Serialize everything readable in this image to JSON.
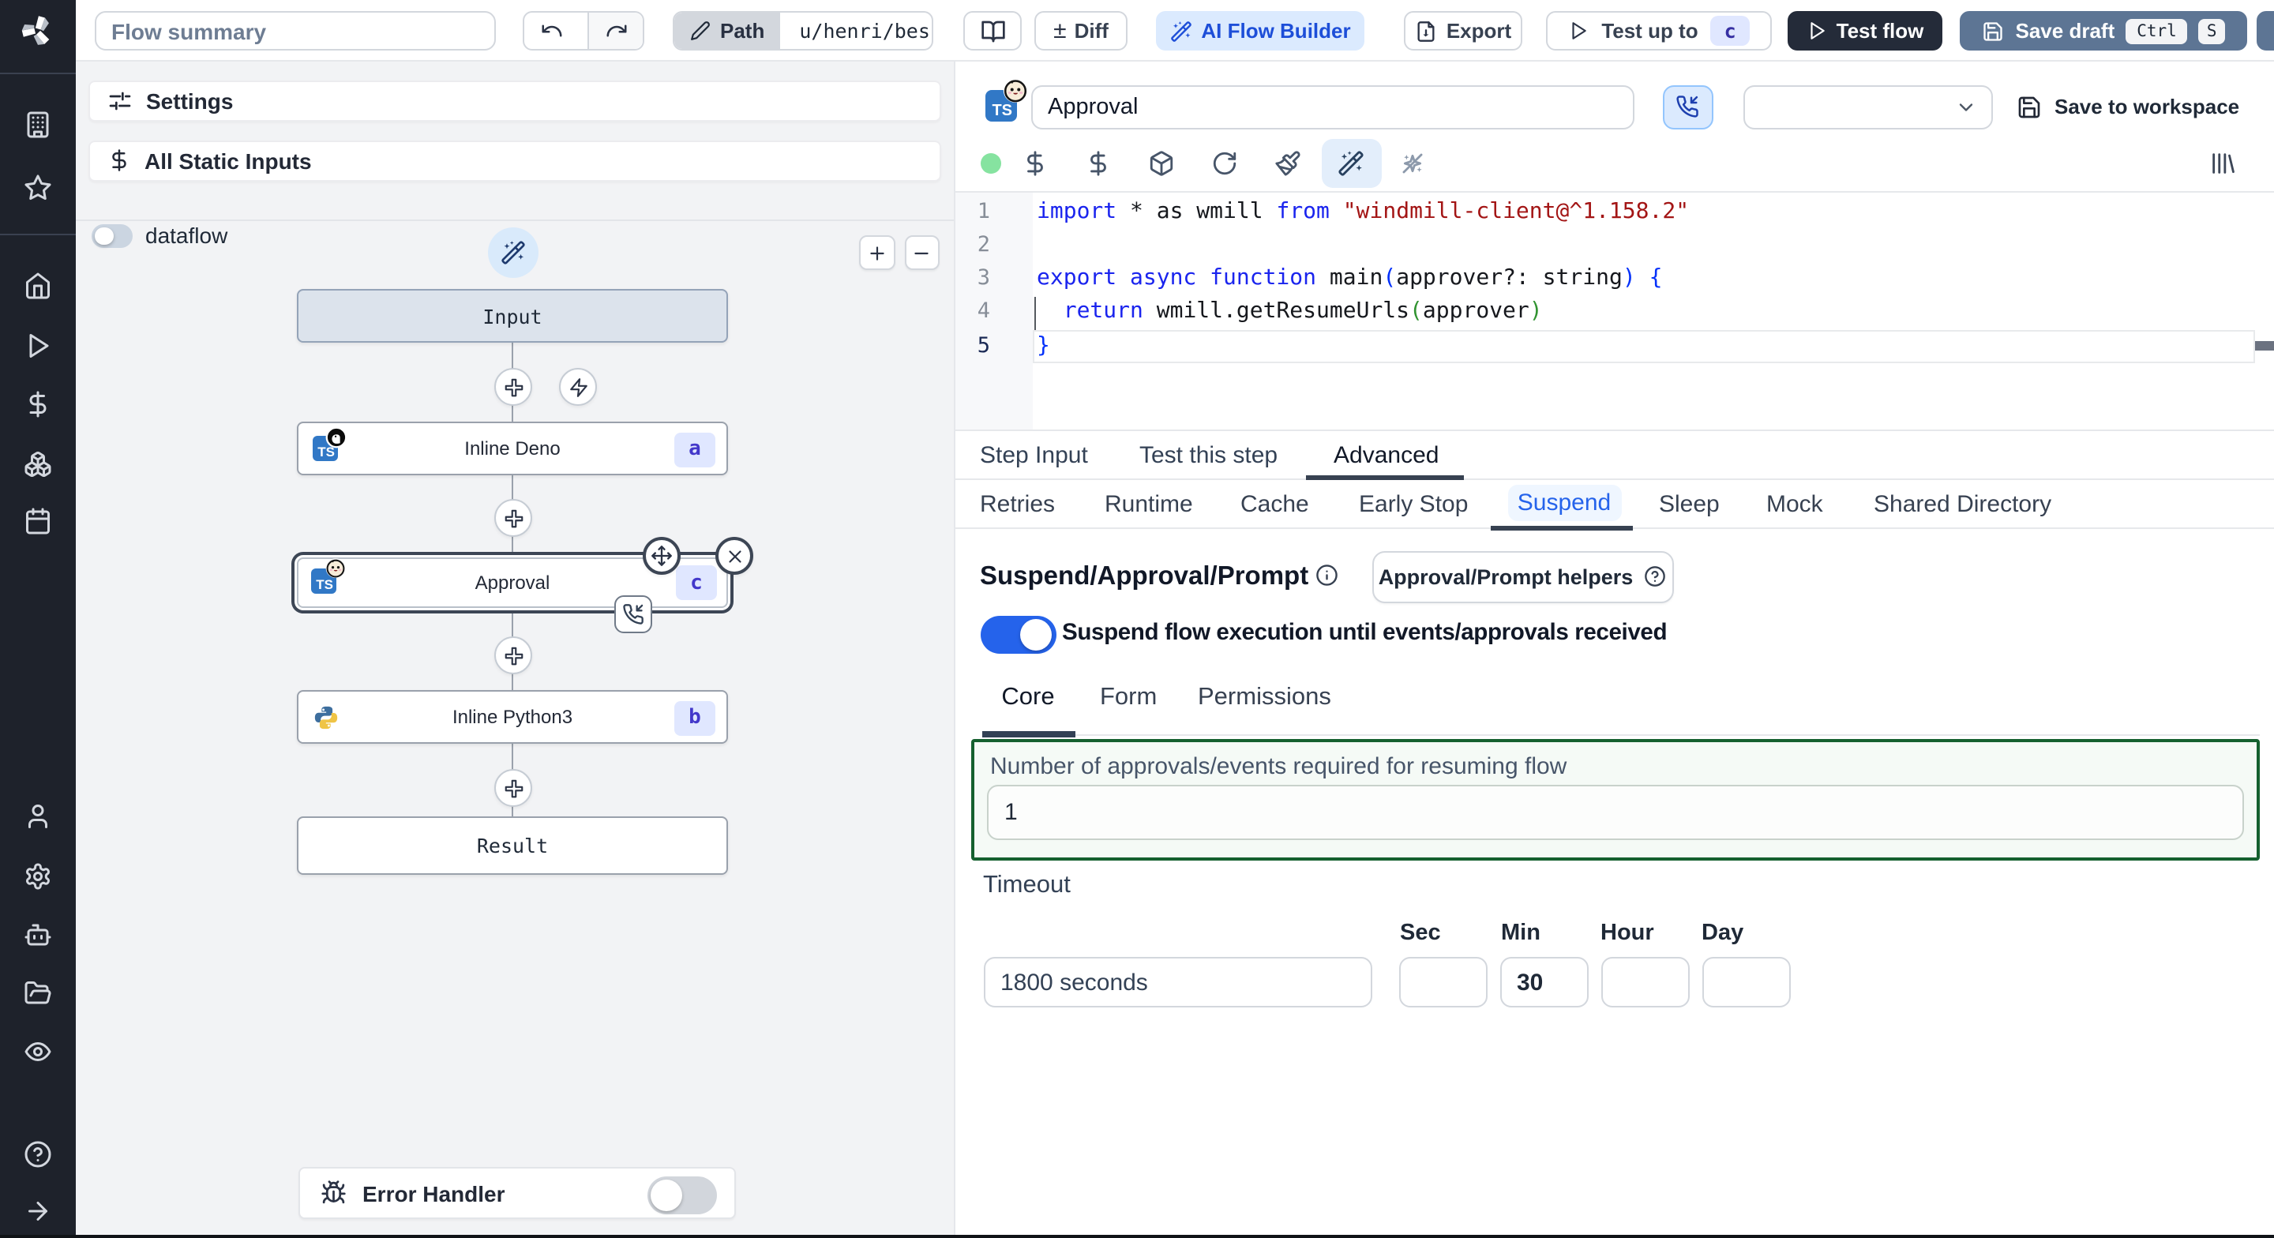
{
  "topbar": {
    "flow_summary_placeholder": "Flow summary",
    "path_label": "Path",
    "path_value": "u/henri/bes",
    "diff_label": "Diff",
    "ai_flow_builder_label": "AI Flow Builder",
    "export_label": "Export",
    "test_up_to_label": "Test up to",
    "test_up_to_badge": "c",
    "test_flow_label": "Test flow",
    "save_draft_label": "Save draft",
    "kbd_ctrl": "Ctrl",
    "kbd_s": "S"
  },
  "left_panel": {
    "settings_label": "Settings",
    "static_inputs_label": "All Static Inputs",
    "dataflow_label": "dataflow",
    "graph": {
      "input_label": "Input",
      "deno_label": "Inline Deno",
      "deno_badge": "a",
      "approval_label": "Approval",
      "approval_badge": "c",
      "python_label": "Inline Python3",
      "python_badge": "b",
      "result_label": "Result",
      "error_handler_label": "Error Handler"
    }
  },
  "editor": {
    "step_name": "Approval",
    "save_to_workspace_label": "Save to workspace",
    "code": {
      "line_numbers": [
        "1",
        "2",
        "3",
        "4",
        "5"
      ],
      "l1": [
        "import",
        " * as wmill ",
        "from",
        " ",
        "\"windmill-client@^1.158.2\""
      ],
      "l3": [
        "export async function",
        " main",
        "(",
        "approver?: string",
        ")",
        " ",
        "{"
      ],
      "l4": [
        "  ",
        "return",
        " wmill.getResumeUrls",
        "(",
        "approver",
        ")"
      ],
      "l5": [
        "}"
      ]
    }
  },
  "tabs": {
    "primary": [
      "Step Input",
      "Test this step",
      "Advanced"
    ],
    "advanced": [
      "Retries",
      "Runtime",
      "Cache",
      "Early Stop",
      "Suspend",
      "Sleep",
      "Mock",
      "Shared Directory"
    ]
  },
  "suspend": {
    "heading": "Suspend/Approval/Prompt",
    "helpers_button_label": "Approval/Prompt helpers",
    "toggle_label": "Suspend flow execution until events/approvals received",
    "subtabs": [
      "Core",
      "Form",
      "Permissions"
    ],
    "approvals_label": "Number of approvals/events required for resuming flow",
    "approvals_value": "1",
    "timeout_label": "Timeout",
    "timeout_placeholder": "1800 seconds",
    "sec_label": "Sec",
    "min_label": "Min",
    "hour_label": "Hour",
    "day_label": "Day",
    "min_value": "30"
  },
  "icons": {
    "ts_label": "TS",
    "plus_minus_glyph": "±"
  },
  "colors": {
    "accent_blue": "#2563eb",
    "suspend_tab_blue": "#2563eb",
    "badge_bg": "#e0e7ff",
    "badge_text": "#4338ca",
    "save_draft_bg": "#5d7594",
    "test_flow_bg": "#242b39",
    "green_panel_border": "#15602f",
    "keyword_blue": "#1a24ee",
    "string_red": "#a31515"
  }
}
